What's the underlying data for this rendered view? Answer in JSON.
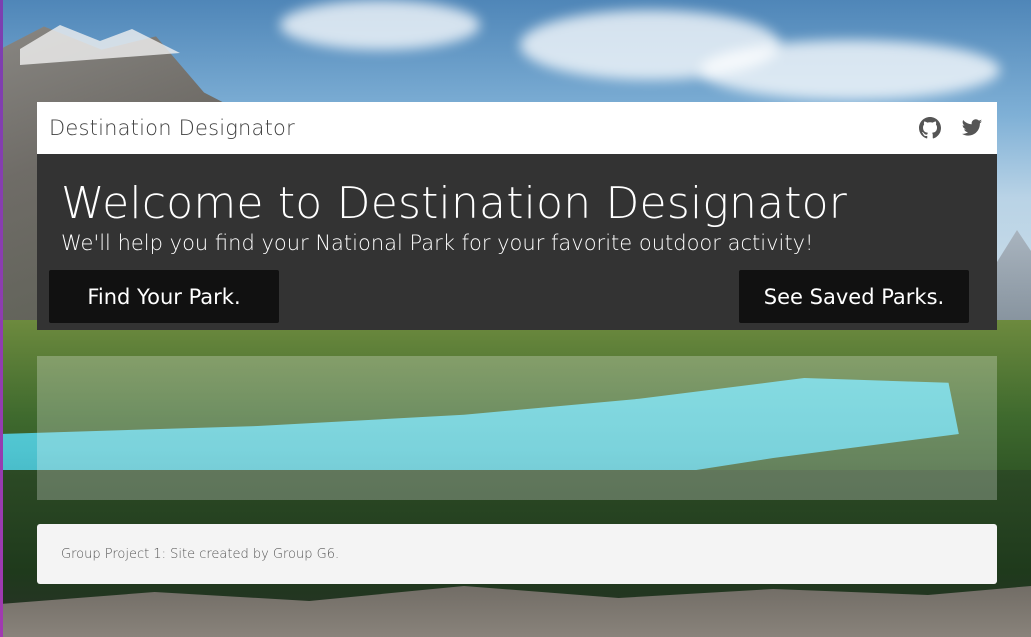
{
  "navbar": {
    "brand": "Destination Designator",
    "icons": [
      "github-icon",
      "twitter-icon"
    ]
  },
  "jumbotron": {
    "title": "Welcome to Destination Designator",
    "subtitle": "We'll help you find your National Park for your favorite outdoor activity!",
    "find_button": "Find Your Park.",
    "saved_button": "See Saved Parks."
  },
  "footer": {
    "text": "Group Project 1: Site created by Group G6."
  },
  "colors": {
    "navbar_bg": "#ffffff",
    "jumbotron_bg": "#333333",
    "button_bg": "#111111",
    "footer_bg": "#f4f4f4"
  }
}
